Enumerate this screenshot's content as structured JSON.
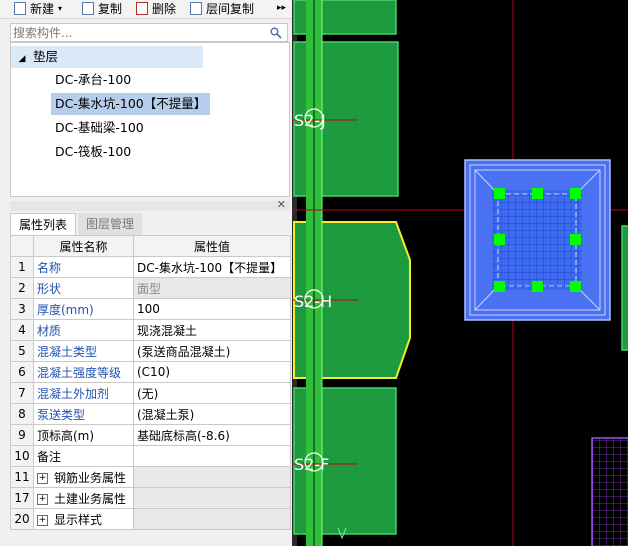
{
  "toolbar": {
    "new_label": "新建",
    "copy_label": "复制",
    "delete_label": "删除",
    "floor_copy_label": "层间复制",
    "more": "▸▸"
  },
  "search": {
    "placeholder": "搜索构件..."
  },
  "tree": {
    "category": "垫层",
    "items": [
      "DC-承台-100",
      "DC-集水坑-100【不提量】",
      "DC-基础梁-100",
      "DC-筏板-100"
    ],
    "selected_index": 1
  },
  "tabs": {
    "properties": "属性列表",
    "layers": "图层管理"
  },
  "grid": {
    "header_name": "属性名称",
    "header_value": "属性值",
    "rows": [
      {
        "num": "1",
        "name": "名称",
        "value": "DC-集水坑-100【不提量】"
      },
      {
        "num": "2",
        "name": "形状",
        "value": "面型"
      },
      {
        "num": "3",
        "name": "厚度(mm)",
        "value": "100"
      },
      {
        "num": "4",
        "name": "材质",
        "value": "现浇混凝土"
      },
      {
        "num": "5",
        "name": "混凝土类型",
        "value": "(泵送商品混凝土)"
      },
      {
        "num": "6",
        "name": "混凝土强度等级",
        "value": "(C10)"
      },
      {
        "num": "7",
        "name": "混凝土外加剂",
        "value": "(无)"
      },
      {
        "num": "8",
        "name": "泵送类型",
        "value": "(混凝土泵)"
      },
      {
        "num": "9",
        "name": "顶标高(m)",
        "value": "基础底标高(-8.6)"
      },
      {
        "num": "10",
        "name": "备注",
        "value": ""
      },
      {
        "num": "11",
        "name": "钢筋业务属性",
        "value": ""
      },
      {
        "num": "17",
        "name": "土建业务属性",
        "value": ""
      },
      {
        "num": "20",
        "name": "显示样式",
        "value": ""
      }
    ]
  },
  "canvas": {
    "axis_labels": [
      "S2-J",
      "S2-H",
      "S2-F"
    ],
    "colors": {
      "background": "#000000",
      "slab": "#1f9b3f",
      "column": "#2fbf3a",
      "pit": "#3d6cf0",
      "selected_outline": "#f5ef2a",
      "grip": "#00ff00",
      "crosshair": "#c0001a",
      "purple_mesh": "#8f3cd0"
    }
  }
}
